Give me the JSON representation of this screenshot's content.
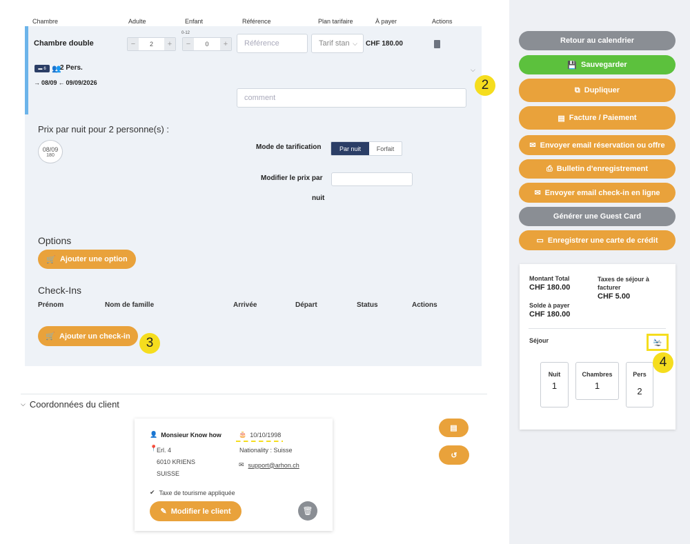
{
  "table_headers": {
    "chambre": "Chambre",
    "adulte": "Adulte",
    "enfant": "Enfant",
    "reference": "Référence",
    "plan": "Plan tarifaire",
    "apayer": "À payer",
    "actions": "Actions"
  },
  "room": {
    "name": "Chambre double",
    "adults": "2",
    "children_age": "0-12",
    "children": "0",
    "reference_placeholder": "Référence",
    "plan_value": "Tarif stan",
    "price": "CHF 180.00",
    "bed_badge": "6",
    "persons": "2 Pers.",
    "dates": "08/09",
    "dates_end": "09/09/2026",
    "comment_placeholder": "comment"
  },
  "nightly": {
    "title": "Prix par nuit pour 2 personne(s) :",
    "date": "08/09",
    "price": "180",
    "mode_label": "Mode de tarification",
    "mode_options": [
      "Par nuit",
      "Forfait"
    ],
    "modify_label_1": "Modifier le prix par",
    "modify_label_2": "nuit"
  },
  "options": {
    "title": "Options",
    "add_button": "Ajouter une option"
  },
  "checkins": {
    "title": "Check-Ins",
    "headers": [
      "Prénom",
      "Nom de famille",
      "Arrivée",
      "Départ",
      "Status",
      "Actions"
    ],
    "add_button": "Ajouter un check-in"
  },
  "client": {
    "section_title": "Coordonnées du client",
    "name": "Monsieur  Know how",
    "birthdate": "10/10/1998",
    "address1": "Erl. 4",
    "address2": "6010 KRIENS",
    "address3": "SUISSE",
    "nationality": "Nationality : Suisse",
    "email": "support@arhon.ch",
    "tax": "Taxe de tourisme appliquée",
    "edit_button": "Modifier le client"
  },
  "sidebar": {
    "buttons": [
      "Retour au calendrier",
      "Sauvegarder",
      "Dupliquer",
      "Facture / Paiement",
      "Envoyer email réservation ou offre",
      "Bulletin d'enregistrement",
      "Envoyer email check-in en ligne",
      "Générer une Guest Card",
      "Enregistrer une carte de crédit"
    ]
  },
  "summary": {
    "total_label": "Montant Total",
    "total_value": "CHF 180.00",
    "tax_label": "Taxes de séjour à facturer",
    "tax_value": "CHF 5.00",
    "balance_label": "Solde à payer",
    "balance_value": "CHF 180.00",
    "stay_label": "Séjour",
    "stats": [
      {
        "label": "Nuit",
        "value": "1"
      },
      {
        "label": "Chambres",
        "value": "1"
      },
      {
        "label": "Pers",
        "value": "2"
      }
    ]
  },
  "markers": [
    "2",
    "3",
    "4"
  ],
  "colors": {
    "orange": "#e9a23b",
    "green": "#5cc13d",
    "gray": "#8a8e94",
    "navy": "#2b3e66",
    "marker": "#f5dd1e"
  }
}
